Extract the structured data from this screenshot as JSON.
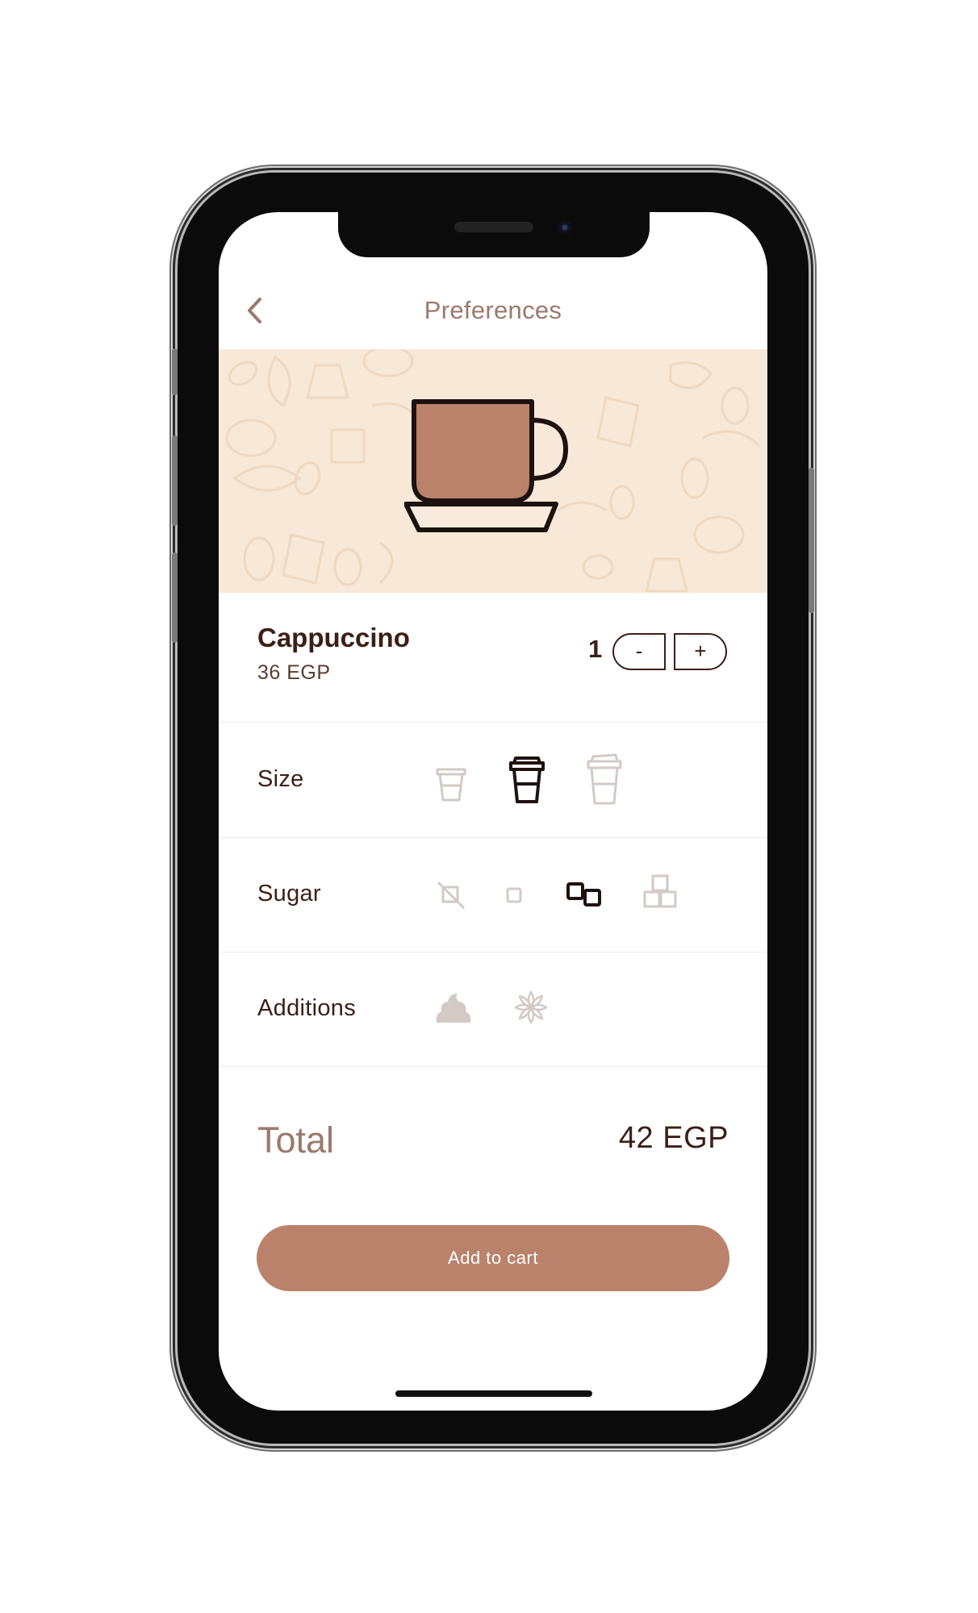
{
  "header": {
    "title": "Preferences",
    "back_icon": "chevron-left-icon"
  },
  "hero": {
    "image": "coffee-cup-icon",
    "background_color": "#f7e8d8",
    "cup_color": "#bb826b"
  },
  "product": {
    "name": "Cappuccino",
    "price": "36 EGP",
    "quantity": "1",
    "minus_label": "-",
    "plus_label": "+"
  },
  "options": {
    "size": {
      "label": "Size",
      "choices": [
        "small-cup-icon",
        "medium-cup-icon",
        "large-cup-icon"
      ],
      "selected": "medium-cup-icon"
    },
    "sugar": {
      "label": "Sugar",
      "choices": [
        "no-sugar-icon",
        "one-sugar-icon",
        "two-sugar-icon",
        "three-sugar-icon"
      ],
      "selected": "two-sugar-icon"
    },
    "additions": {
      "label": "Additions",
      "choices": [
        "cream-icon",
        "cinnamon-icon"
      ],
      "selected": null
    }
  },
  "total": {
    "label": "Total",
    "value": "42 EGP"
  },
  "cart": {
    "label": "Add to cart"
  },
  "colors": {
    "accent": "#bb826b",
    "dark": "#3b1f16",
    "muted": "#9b7a6e",
    "inactive": "#d3cac6"
  }
}
